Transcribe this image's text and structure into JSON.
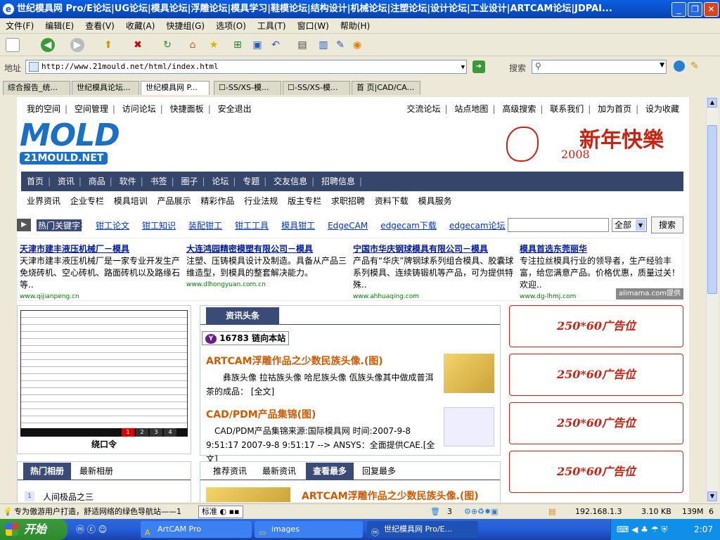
{
  "window": {
    "title": "世纪模具网 Pro/E论坛|UG论坛|模具论坛|浮雕论坛|模具学习|鞋模论坛|结构设计|机械论坛|注塑论坛|设计论坛|工业设计|ARTCAM论坛|JDPAI..."
  },
  "menu": [
    "文件(F)",
    "编辑(E)",
    "查看(V)",
    "收藏(A)",
    "快捷组(G)",
    "选项(O)",
    "工具(T)",
    "窗口(W)",
    "帮助(H)"
  ],
  "address": {
    "label": "地址",
    "url": "http://www.21mould.net/html/index.html",
    "search_label": "搜索"
  },
  "tabs": [
    "综合报告_统...",
    "世纪模具论坛...",
    "世纪模具网 P...",
    "☐-SS/XS-模...",
    "☐-SS/XS-模...",
    "首 页|CAD/CA..."
  ],
  "site": {
    "top_left_links": [
      "我的空间",
      "空间管理",
      "访问论坛",
      "快捷面板",
      "安全退出"
    ],
    "top_right_links": [
      "交流论坛",
      "站点地图",
      "高级搜索",
      "联系我们",
      "加为首页",
      "设为收藏"
    ],
    "logo_main": "MOLD",
    "logo_sub": "21MOULD.NET",
    "banner_text": "新年快樂",
    "banner_year": "2008",
    "nav": [
      "首页",
      "资讯",
      "商品",
      "软件",
      "书签",
      "圈子",
      "论坛",
      "专题",
      "交友信息",
      "招聘信息"
    ],
    "subnav": [
      "业界资讯",
      "企业专栏",
      "模具培训",
      "产品展示",
      "精彩作品",
      "行业法规",
      "版主专栏",
      "求职招聘",
      "资料下载",
      "模具服务"
    ],
    "hot_label": "热门关键字",
    "hot_links": [
      "钳工论文",
      "钳工知识",
      "装配钳工",
      "钳工工具",
      "模具钳工",
      "EdgeCAM",
      "edgecam下载",
      "edgecam论坛"
    ],
    "search_scope": "全部",
    "search_button": "搜索",
    "ads": [
      {
        "title": "天津市建丰液压机械厂－模具",
        "desc": "天津市建丰液压机械厂是一家专业开发生产免烧砖机、空心砖机、路面砖机以及路缘石等..",
        "url": "www.qijianpeng.cn"
      },
      {
        "title": "大连鸿园精密模塑有限公司－模具",
        "desc": "注塑、压铸模具设计及制造。具备从产品三维造型，到模具的整套解决能力。",
        "url": "www.dlhongyuan.com.cn"
      },
      {
        "title": "宁国市华庆钢球模具有限公司－模具",
        "desc": "产品有“华庆”牌钢球系列组合模具、胶囊球系列模具、连续铸锻机等产品，可为提供特殊..",
        "url": "www.ahhuaqing.com"
      },
      {
        "title": "模具首选东莞丽华",
        "desc": "专注拉丝模具行业的领导者，生产经验丰富，给您满意产品。价格优惠，质量过关！欢迎..",
        "url": "www.dg-lhmj.com"
      }
    ],
    "alimama": "alimama.com提供",
    "doc_caption": "绕口令",
    "doc_pages": [
      "1",
      "2",
      "3",
      "4"
    ],
    "news_header": "资讯头条",
    "yahoo_badge": "16783 链向本站",
    "news": [
      {
        "title": "ARTCAM浮雕作品之少数民族头像.(图)",
        "body": "彝族头像 拉祜族头像 哈尼族头像 佤族头像其中做成普洱茶的成品：",
        "more": "[全文]"
      },
      {
        "title": "CAD/PDM产品集锦(图)",
        "body": "CAD/PDM产品集锦来源:国际模具网 时间:2007-9-8 9:51:17 2007-9-8 9:51:17 --> ANSYS：全面提供CAE.",
        "more": "[全文]"
      }
    ],
    "album_tabs": [
      "热门相册",
      "最新相册"
    ],
    "album_first": "人间极品之三",
    "album_num": "1",
    "info_tabs": [
      "推荐资讯",
      "最新资讯",
      "查看最多",
      "回复最多"
    ],
    "info_first": "ARTCAM浮雕作品之少数民族头像.(图)",
    "ad_slots": [
      "250*60广告位",
      "250*60广告位",
      "250*60广告位",
      "250*60广告位"
    ]
  },
  "status": {
    "message": "专为傲游用户打造，舒适网络的绿色导航站——1",
    "ime": "标准",
    "count": "3",
    "ip": "192.168.1.3",
    "size": "3.10 KB",
    "mem": "139M",
    "num": "6"
  },
  "taskbar": {
    "start": "开始",
    "tasks": [
      "ArtCAM Pro",
      "images",
      "世纪模具网 Pro/E..."
    ],
    "clock": "2:07"
  }
}
